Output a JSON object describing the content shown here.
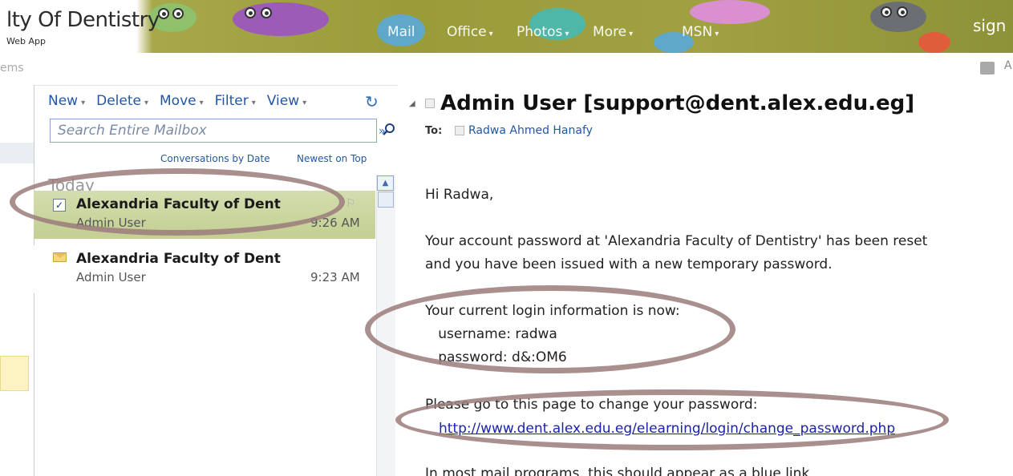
{
  "header": {
    "title": "lty Of Dentistry",
    "subtitle": "Web App",
    "nav": [
      {
        "label": "Mail",
        "has_dropdown": false
      },
      {
        "label": "Office",
        "has_dropdown": true
      },
      {
        "label": "Photos",
        "has_dropdown": true
      },
      {
        "label": "More",
        "has_dropdown": true
      },
      {
        "label": "MSN",
        "has_dropdown": true
      }
    ],
    "sign_in": "sign"
  },
  "left_pane": {
    "items_label": "ems"
  },
  "toolbar": {
    "new": "New",
    "delete": "Delete",
    "move": "Move",
    "filter": "Filter",
    "view": "View",
    "dropdown_glyph": "▾"
  },
  "search": {
    "placeholder": "Search Entire Mailbox"
  },
  "list_options": {
    "conversations": "Conversations by Date",
    "sort": "Newest on Top"
  },
  "group_label": "Today",
  "messages": [
    {
      "subject": "Alexandria Faculty of Dent",
      "sender": "Admin User",
      "time": "9:26 AM",
      "selected": true,
      "check": "✓"
    },
    {
      "subject": "Alexandria Faculty of Dent",
      "sender": "Admin User",
      "time": "9:23 AM",
      "selected": false
    }
  ],
  "reading": {
    "from": "Admin User [support@dent.alex.edu.eg]",
    "to_label": "To:",
    "to_name": "Radwa Ahmed Hanafy",
    "greeting": "Hi Radwa,",
    "para1_line1": "Your account password at 'Alexandria Faculty of Dentistry' has been reset",
    "para1_line2": "and you have been issued with a new temporary password.",
    "login_intro": "Your current login information is now:",
    "username_line": "   username: radwa",
    "password_line": "   password: d&:OM6",
    "change_intro": "Please go to this page to change your password:",
    "link": "http://www.dent.alex.edu.eg/elearning/login/change_password.php",
    "footer": "In most mail programs, this should appear as a blue link"
  },
  "colors": {
    "accent_link": "#2356a8",
    "selected_row": "#c3cf93",
    "oval": "#9b7b7b"
  }
}
